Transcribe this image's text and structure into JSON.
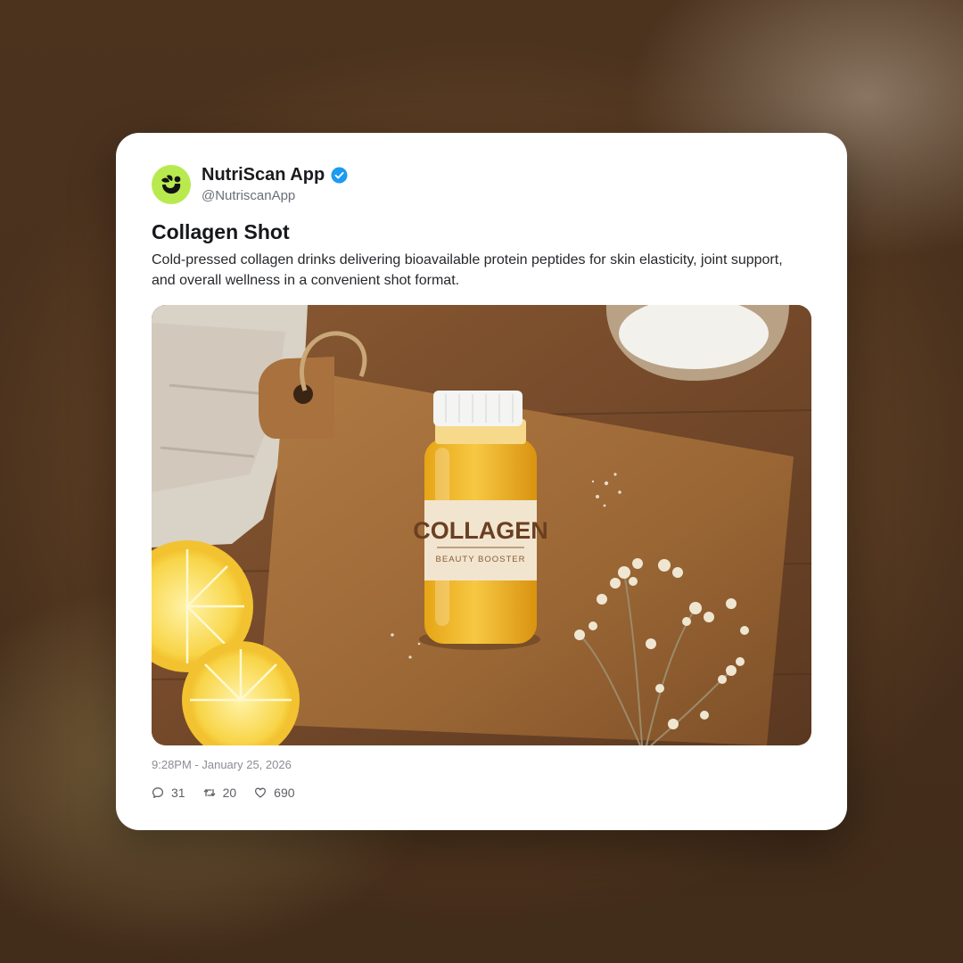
{
  "post": {
    "author": {
      "display_name": "NutriScan App",
      "handle": "@NutriscanApp",
      "verified": true,
      "avatar_icon": "leaf-logo-icon",
      "avatar_color": "#b8ea4f"
    },
    "title": "Collagen Shot",
    "description": "Cold-pressed collagen drinks delivering bioavailable protein peptides for skin elasticity, joint support, and overall wellness in a convenient shot format.",
    "image": {
      "label_main": "COLLAGEN",
      "label_sub": "BEAUTY BOOSTER"
    },
    "timestamp": "9:28PM - January 25, 2026",
    "stats": {
      "replies": "31",
      "reposts": "20",
      "likes": "690"
    }
  },
  "colors": {
    "verified_badge": "#1d9bf0",
    "card_background": "#ffffff"
  }
}
